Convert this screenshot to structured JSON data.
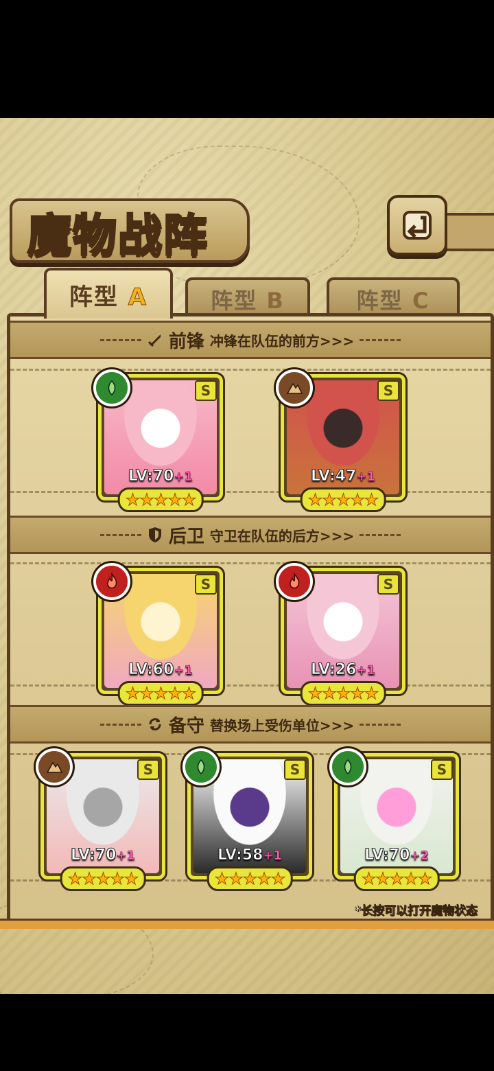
{
  "title": "魔物战阵",
  "back_icon": "back-arrow-icon",
  "tabs": [
    {
      "label": "阵型",
      "letter": "A",
      "active": true
    },
    {
      "label": "阵型",
      "letter": "B",
      "active": false
    },
    {
      "label": "阵型",
      "letter": "C",
      "active": false
    }
  ],
  "sections": {
    "front": {
      "icon": "sword-icon",
      "title": "前锋",
      "desc": "冲锋在队伍的前方>>>"
    },
    "back": {
      "icon": "shield-icon",
      "title": "后卫",
      "desc": "守卫在队伍的后方>>>"
    },
    "reserve": {
      "icon": "swap-icon",
      "title": "备守",
      "desc": "替换场上受伤单位>>>"
    }
  },
  "cards": {
    "front1": {
      "element": "nature",
      "level": "LV:70",
      "plus": "+1",
      "rarity": "S",
      "stars": "★★★★★",
      "colors": [
        "#f7b8c8",
        "#f28aa6",
        "#fff"
      ]
    },
    "front2": {
      "element": "earth",
      "level": "LV:47",
      "plus": "+1",
      "rarity": "S",
      "stars": "★★★★★",
      "colors": [
        "#d2524c",
        "#c9733c",
        "#3a2a2a"
      ]
    },
    "back1": {
      "element": "fire",
      "level": "LV:60",
      "plus": "+1",
      "rarity": "S",
      "stars": "★★★★★",
      "colors": [
        "#f6d56e",
        "#f0a8c0",
        "#fff4d0"
      ]
    },
    "back2": {
      "element": "fire",
      "level": "LV:26",
      "plus": "+1",
      "rarity": "S",
      "stars": "★★★★★",
      "colors": [
        "#f4c6d6",
        "#e892b4",
        "#fff"
      ]
    },
    "reserve1": {
      "element": "earth",
      "level": "LV:70",
      "plus": "+1",
      "rarity": "S",
      "stars": "★★★★★",
      "colors": [
        "#e9e9e9",
        "#f4b8b8",
        "#a6a6a6"
      ]
    },
    "reserve2": {
      "element": "nature",
      "level": "LV:58",
      "plus": "+1",
      "rarity": "S",
      "stars": "★★★★★",
      "colors": [
        "#fafafa",
        "#2a2a2a",
        "#5a3a8a"
      ]
    },
    "reserve3": {
      "element": "nature",
      "level": "LV:70",
      "plus": "+2",
      "rarity": "S",
      "stars": "★★★★★",
      "colors": [
        "#f2f2ee",
        "#d8e8d0",
        "#ff9ed8"
      ]
    }
  },
  "footer_note": "*长按可以打开魔物状态"
}
